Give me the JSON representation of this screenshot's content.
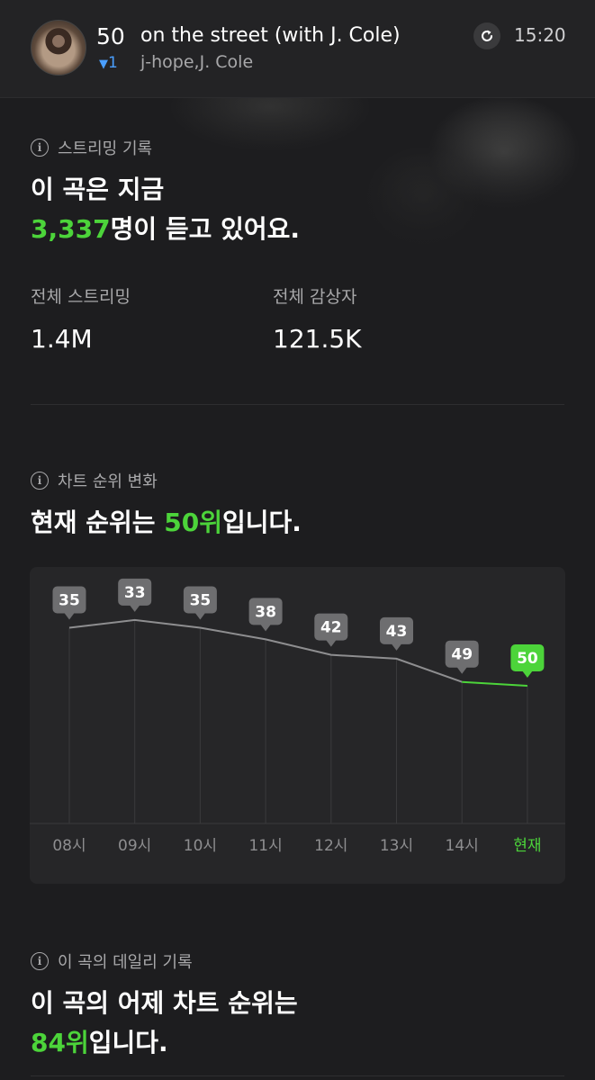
{
  "header": {
    "rank": "50",
    "title": "on the street (with J. Cole)",
    "rank_change": "1",
    "artists": "j-hope,J. Cole",
    "time": "15:20"
  },
  "streaming": {
    "section_label": "스트리밍 기록",
    "headline_line1": "이 곡은 지금",
    "listeners_now": "3,337",
    "headline_suffix": "명이 듣고 있어요.",
    "total_streams_label": "전체 스트리밍",
    "total_streams_value": "1.4M",
    "total_listeners_label": "전체 감상자",
    "total_listeners_value": "121.5K"
  },
  "chart_rank": {
    "section_label": "차트 순위 변화",
    "headline_prefix": "현재 순위는 ",
    "current_rank": "50위",
    "headline_suffix": "입니다."
  },
  "chart_data": {
    "type": "line",
    "categories": [
      "08시",
      "09시",
      "10시",
      "11시",
      "12시",
      "13시",
      "14시",
      "현재"
    ],
    "values": [
      35,
      33,
      35,
      38,
      42,
      43,
      49,
      50
    ],
    "highlight_index": 7,
    "colors": {
      "line": "#8e8e90",
      "current": "#4cd43a",
      "label_bg": "#6e6e70",
      "grid": "#3a3a3c"
    }
  },
  "daily": {
    "section_label": "이 곡의 데일리 기록",
    "headline_line1": "이 곡의 어제 차트 순위는",
    "yesterday_rank": "84위",
    "headline_suffix": "입니다."
  }
}
